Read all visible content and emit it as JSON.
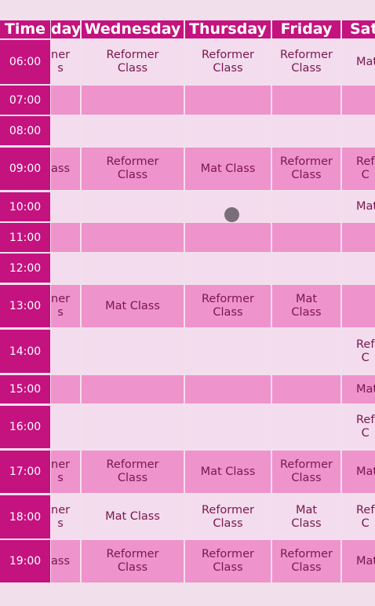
{
  "header": {
    "time": "Time",
    "monday_partial": "day",
    "wednesday": "Wednesday",
    "thursday": "Thursday",
    "friday": "Friday",
    "saturday_partial": "Sat"
  },
  "colors": {
    "accent": "#c4127f",
    "row_pink": "#ef93cc",
    "row_light": "#f3dced",
    "text": "#7a1650"
  },
  "rows": [
    {
      "time": "06:00",
      "monday": "ner\ns",
      "wednesday": "Reformer\nClass",
      "thursday": "Reformer\nClass",
      "friday": "Reformer\nClass",
      "saturday": "Mat"
    },
    {
      "time": "07:00",
      "monday": "",
      "wednesday": "",
      "thursday": "",
      "friday": "",
      "saturday": ""
    },
    {
      "time": "08:00",
      "monday": "",
      "wednesday": "",
      "thursday": "",
      "friday": "",
      "saturday": ""
    },
    {
      "time": "09:00",
      "monday": "ass",
      "wednesday": "Reformer\nClass",
      "thursday": "Mat Class",
      "friday": "Reformer\nClass",
      "saturday": "Ref\nC"
    },
    {
      "time": "10:00",
      "monday": "",
      "wednesday": "",
      "thursday": "",
      "friday": "",
      "saturday": "Mat"
    },
    {
      "time": "11:00",
      "monday": "",
      "wednesday": "",
      "thursday": "",
      "friday": "",
      "saturday": ""
    },
    {
      "time": "12:00",
      "monday": "",
      "wednesday": "",
      "thursday": "",
      "friday": "",
      "saturday": ""
    },
    {
      "time": "13:00",
      "monday": "ner\ns",
      "wednesday": "Mat Class",
      "thursday": "Reformer\nClass",
      "friday": "Mat\nClass",
      "saturday": ""
    },
    {
      "time": "14:00",
      "monday": "",
      "wednesday": "",
      "thursday": "",
      "friday": "",
      "saturday": "Ref\nC"
    },
    {
      "time": "15:00",
      "monday": "",
      "wednesday": "",
      "thursday": "",
      "friday": "",
      "saturday": "Mat"
    },
    {
      "time": "16:00",
      "monday": "",
      "wednesday": "",
      "thursday": "",
      "friday": "",
      "saturday": "Ref\nC"
    },
    {
      "time": "17:00",
      "monday": "ner\ns",
      "wednesday": "Reformer\nClass",
      "thursday": "Mat Class",
      "friday": "Reformer\nClass",
      "saturday": "Mat"
    },
    {
      "time": "18:00",
      "monday": "ner\ns",
      "wednesday": "Mat Class",
      "thursday": "Reformer\nClass",
      "friday": "Mat\nClass",
      "saturday": "Ref\nC"
    },
    {
      "time": "19:00",
      "monday": "ass",
      "wednesday": "Reformer\nClass",
      "thursday": "Reformer\nClass",
      "friday": "Reformer\nClass",
      "saturday": "Mat"
    }
  ]
}
